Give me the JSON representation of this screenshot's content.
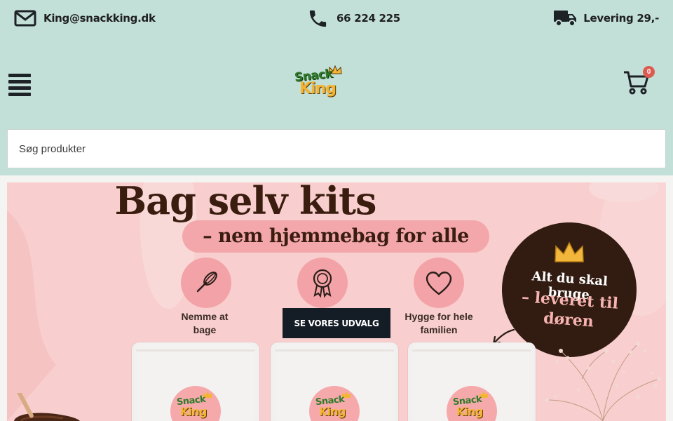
{
  "topbar": {
    "email": "King@snackking.dk",
    "phone": "66 224 225",
    "delivery": "Levering 29,-"
  },
  "logo": {
    "line1": "Snack",
    "line2": "King"
  },
  "cart": {
    "count": "0"
  },
  "search": {
    "placeholder": "Søg produkter"
  },
  "hero": {
    "title": "Bag selv kits",
    "subtitle": "– nem hjemmebag for alle",
    "features": [
      {
        "icon": "whisk-icon",
        "label_line1": "Nemme at",
        "label_line2": "bage"
      },
      {
        "icon": "award-icon",
        "label_line1": "",
        "label_line2": ""
      },
      {
        "icon": "heart-icon",
        "label_line1": "Hygge for hele",
        "label_line2": "familien"
      }
    ],
    "cta_label": "SE VORES UDVALG",
    "badge_line1": "Alt du skal bruge",
    "badge_line2": "– leveret til",
    "badge_line3": "døren",
    "pouch_logo_line1": "Snack",
    "pouch_logo_line2": "King"
  },
  "colors": {
    "header_bg": "#c2e0d8",
    "hero_bg": "#f8cfce",
    "cta_bg": "#141c26",
    "badge_bg": "#321c12",
    "cart_badge": "#dd5a50",
    "logo_green": "#2f7a2a",
    "logo_yellow": "#f4b533"
  }
}
